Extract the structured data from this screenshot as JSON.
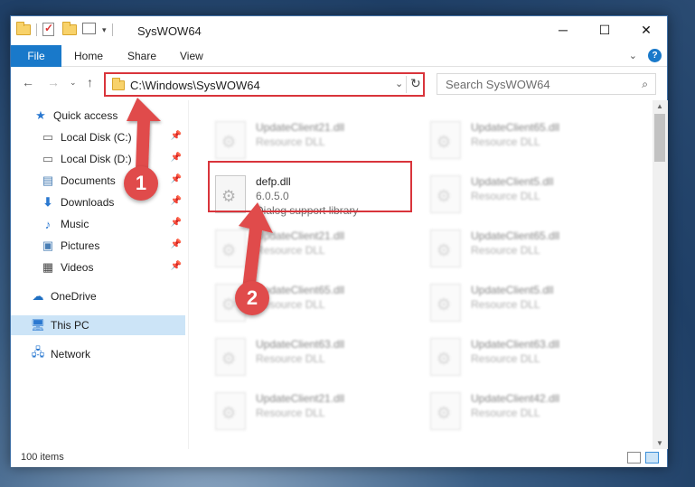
{
  "window": {
    "title": "SysWOW64",
    "controls": {
      "minimize": "─",
      "maximize": "☐",
      "close": "✕"
    }
  },
  "ribbon": {
    "tabs": [
      "File",
      "Home",
      "Share",
      "View"
    ],
    "help": "?"
  },
  "address": {
    "path": "C:\\Windows\\SysWOW64",
    "search_placeholder": "Search SysWOW64"
  },
  "sidebar": {
    "quick_access": "Quick access",
    "pinned": [
      {
        "label": "Local Disk (C:)",
        "icon": "drive-icon"
      },
      {
        "label": "Local Disk (D:)",
        "icon": "drive-icon"
      },
      {
        "label": "Documents",
        "icon": "documents-icon"
      },
      {
        "label": "Downloads",
        "icon": "downloads-icon"
      },
      {
        "label": "Music",
        "icon": "music-icon"
      },
      {
        "label": "Pictures",
        "icon": "pictures-icon"
      },
      {
        "label": "Videos",
        "icon": "videos-icon"
      }
    ],
    "onedrive": "OneDrive",
    "this_pc": "This PC",
    "network": "Network"
  },
  "files": {
    "highlighted": {
      "name": "defp.dll",
      "version": "6.0.5.0",
      "description": "Dialog support library"
    },
    "left_column": [
      {
        "name": "UpdateClient21.dll",
        "description": "Resource DLL"
      },
      {
        "name": "UpdateClient21.dll",
        "description": "Resource DLL"
      },
      {
        "name": "UpdateClient65.dll",
        "description": "Resource DLL"
      },
      {
        "name": "UpdateClient63.dll",
        "description": "Resource DLL"
      },
      {
        "name": "UpdateClient21.dll",
        "description": "Resource DLL"
      }
    ],
    "right_column": [
      {
        "name": "UpdateClient65.dll",
        "description": "Resource DLL"
      },
      {
        "name": "UpdateClient5.dll",
        "description": "Resource DLL"
      },
      {
        "name": "UpdateClient65.dll",
        "description": "Resource DLL"
      },
      {
        "name": "UpdateClient5.dll",
        "description": "Resource DLL"
      },
      {
        "name": "UpdateClient63.dll",
        "description": "Resource DLL"
      },
      {
        "name": "UpdateClient42.dll",
        "description": "Resource DLL"
      }
    ]
  },
  "status": {
    "items": "100 items"
  },
  "annotations": {
    "step1": "1",
    "step2": "2",
    "color": "#e04b4b"
  }
}
